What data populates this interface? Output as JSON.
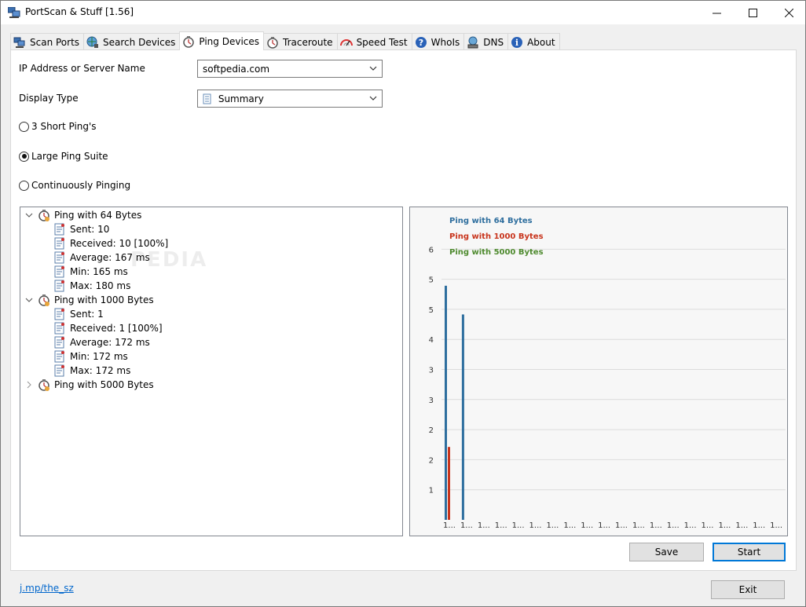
{
  "window": {
    "title": "PortScan & Stuff [1.56]"
  },
  "tabs": [
    {
      "label": "Scan Ports",
      "icon": "network-icon"
    },
    {
      "label": "Search Devices",
      "icon": "globe-search-icon"
    },
    {
      "label": "Ping Devices",
      "icon": "stopwatch-icon",
      "active": true
    },
    {
      "label": "Traceroute",
      "icon": "stopwatch-icon"
    },
    {
      "label": "Speed Test",
      "icon": "speedometer-icon"
    },
    {
      "label": "WhoIs",
      "icon": "question-icon"
    },
    {
      "label": "DNS",
      "icon": "dns-server-icon"
    },
    {
      "label": "About",
      "icon": "info-icon"
    }
  ],
  "form": {
    "ip_label": "IP Address or Server Name",
    "ip_value": "softpedia.com",
    "display_label": "Display Type",
    "display_value": "Summary"
  },
  "radios": [
    {
      "label": "3 Short Ping's",
      "checked": false
    },
    {
      "label": "Large Ping Suite",
      "checked": true
    },
    {
      "label": "Continuously Pinging",
      "checked": false
    }
  ],
  "tree": {
    "groups": [
      {
        "label": "Ping with 64 Bytes",
        "expanded": true,
        "items": [
          "Sent: 10",
          "Received: 10 [100%]",
          "Average: 167 ms",
          "Min: 165 ms",
          "Max: 180 ms"
        ]
      },
      {
        "label": "Ping with 1000 Bytes",
        "expanded": true,
        "items": [
          "Sent: 1",
          "Received: 1 [100%]",
          "Average: 172 ms",
          "Min: 172 ms",
          "Max: 172 ms"
        ]
      },
      {
        "label": "Ping with 5000 Bytes",
        "expanded": false,
        "items": []
      }
    ]
  },
  "chart_data": {
    "type": "bar",
    "series": [
      {
        "name": "Ping with 64 Bytes",
        "color": "#2e6e9e",
        "values": [
          5.3,
          4.65,
          0,
          0,
          0,
          0,
          0,
          0,
          0,
          0,
          0,
          0,
          0,
          0,
          0,
          0,
          0,
          0,
          0,
          0
        ]
      },
      {
        "name": "Ping with 1000 Bytes",
        "color": "#c8341c",
        "values": [
          1.65,
          0,
          0,
          0,
          0,
          0,
          0,
          0,
          0,
          0,
          0,
          0,
          0,
          0,
          0,
          0,
          0,
          0,
          0,
          0
        ]
      },
      {
        "name": "Ping with 5000 Bytes",
        "color": "#4e8a2e",
        "values": [
          0,
          0,
          0,
          0,
          0,
          0,
          0,
          0,
          0,
          0,
          0,
          0,
          0,
          0,
          0,
          0,
          0,
          0,
          0,
          0
        ]
      }
    ],
    "categories": [
      "1...",
      "1...",
      "1...",
      "1...",
      "1...",
      "1...",
      "1...",
      "1...",
      "1...",
      "1...",
      "1...",
      "1...",
      "1...",
      "1...",
      "1...",
      "1...",
      "1...",
      "1...",
      "1...",
      "1..."
    ],
    "yticks": [
      "1",
      "2",
      "2",
      "3",
      "3",
      "4",
      "5",
      "5",
      "6"
    ],
    "ylim": [
      0,
      6.4
    ],
    "legend": "top-left",
    "grid": true
  },
  "buttons": {
    "save": "Save",
    "start": "Start",
    "exit": "Exit"
  },
  "footer": {
    "link": "j.mp/the_sz"
  },
  "watermark": "PEDIA"
}
